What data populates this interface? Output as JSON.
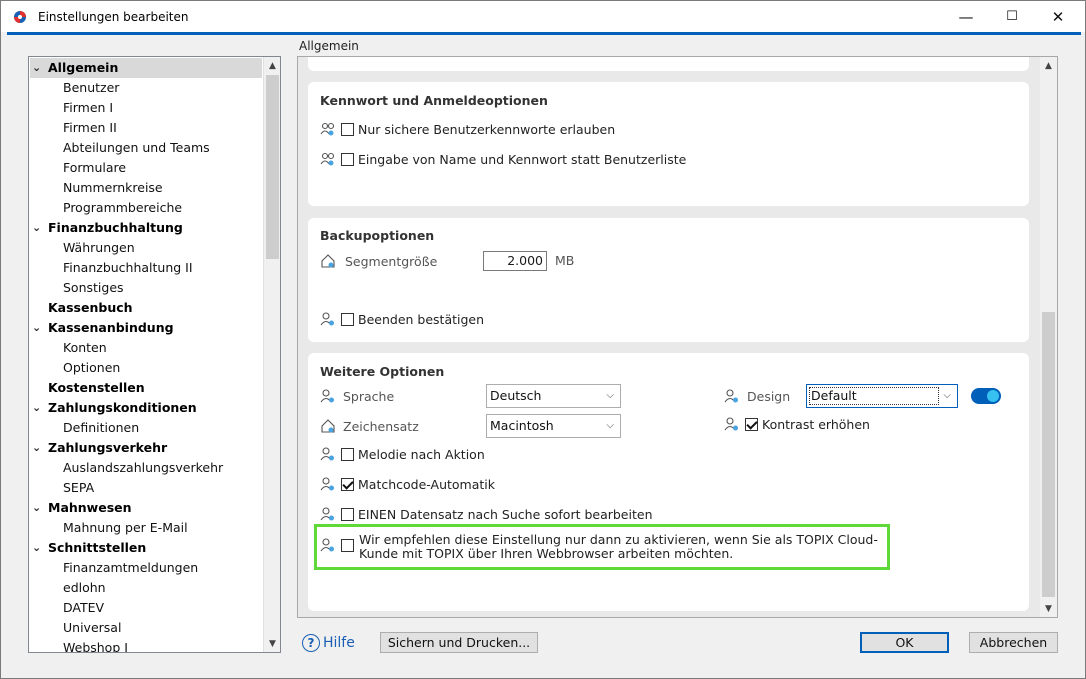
{
  "window": {
    "title": "Einstellungen bearbeiten",
    "minimize": "—",
    "maximize": "☐",
    "close": "✕"
  },
  "section_label": "Allgemein",
  "tree": [
    {
      "label": "Allgemein",
      "level": 0,
      "expanded": true,
      "selected": true
    },
    {
      "label": "Benutzer",
      "level": 1
    },
    {
      "label": "Firmen I",
      "level": 1
    },
    {
      "label": "Firmen II",
      "level": 1
    },
    {
      "label": "Abteilungen und Teams",
      "level": 1
    },
    {
      "label": "Formulare",
      "level": 1
    },
    {
      "label": "Nummernkreise",
      "level": 1
    },
    {
      "label": "Programmbereiche",
      "level": 1
    },
    {
      "label": "Finanzbuchhaltung",
      "level": 0,
      "expanded": true
    },
    {
      "label": "Währungen",
      "level": 1
    },
    {
      "label": "Finanzbuchhaltung II",
      "level": 1
    },
    {
      "label": "Sonstiges",
      "level": 1
    },
    {
      "label": "Kassenbuch",
      "level": 0
    },
    {
      "label": "Kassenanbindung",
      "level": 0,
      "expanded": true
    },
    {
      "label": "Konten",
      "level": 1
    },
    {
      "label": "Optionen",
      "level": 1
    },
    {
      "label": "Kostenstellen",
      "level": 0
    },
    {
      "label": "Zahlungskonditionen",
      "level": 0,
      "expanded": true
    },
    {
      "label": "Definitionen",
      "level": 1
    },
    {
      "label": "Zahlungsverkehr",
      "level": 0,
      "expanded": true
    },
    {
      "label": "Auslandszahlungsverkehr",
      "level": 1
    },
    {
      "label": "SEPA",
      "level": 1
    },
    {
      "label": "Mahnwesen",
      "level": 0,
      "expanded": true
    },
    {
      "label": "Mahnung per E-Mail",
      "level": 1
    },
    {
      "label": "Schnittstellen",
      "level": 0,
      "expanded": true
    },
    {
      "label": "Finanzamtmeldungen",
      "level": 1
    },
    {
      "label": "edlohn",
      "level": 1
    },
    {
      "label": "DATEV",
      "level": 1
    },
    {
      "label": "Universal",
      "level": 1
    },
    {
      "label": "Webshop I",
      "level": 1
    }
  ],
  "password_section": {
    "title": "Kennwort und Anmeldeoptionen",
    "opt_secure_passwords": "Nur sichere Benutzerkennworte erlauben",
    "opt_name_password_entry": "Eingabe von Name und Kennwort statt Benutzerliste"
  },
  "backup_section": {
    "title": "Backupoptionen",
    "segment_size_label": "Segmentgröße",
    "segment_size_value": "2.000",
    "segment_size_unit": "MB",
    "confirm_exit_label": "Beenden bestätigen"
  },
  "more_section": {
    "title": "Weitere Optionen",
    "language_label": "Sprache",
    "language_value": "Deutsch",
    "charset_label": "Zeichensatz",
    "charset_value": "Macintosh",
    "design_label": "Design",
    "design_value": "Default",
    "design_toggle_on": true,
    "contrast_label": "Kontrast erhöhen",
    "contrast_checked": true,
    "melody_label": "Melodie nach Aktion",
    "melody_checked": false,
    "matchcode_label": "Matchcode-Automatik",
    "matchcode_checked": true,
    "edit_single_label": "EINEN Datensatz nach Suche sofort bearbeiten",
    "edit_single_checked": false,
    "cloud_hint_line1": "Wir empfehlen diese Einstellung nur dann zu aktivieren, wenn Sie als TOPIX Cloud-",
    "cloud_hint_line2": "Kunde mit TOPIX über Ihren Webbrowser arbeiten möchten.",
    "cloud_checked": false
  },
  "footer": {
    "help_label": "Hilfe",
    "save_print_label": "Sichern und Drucken...",
    "ok_label": "OK",
    "cancel_label": "Abbrechen"
  },
  "colors": {
    "accent": "#005fb8",
    "highlight": "#5fd93a",
    "help": "#1a5fb4"
  }
}
